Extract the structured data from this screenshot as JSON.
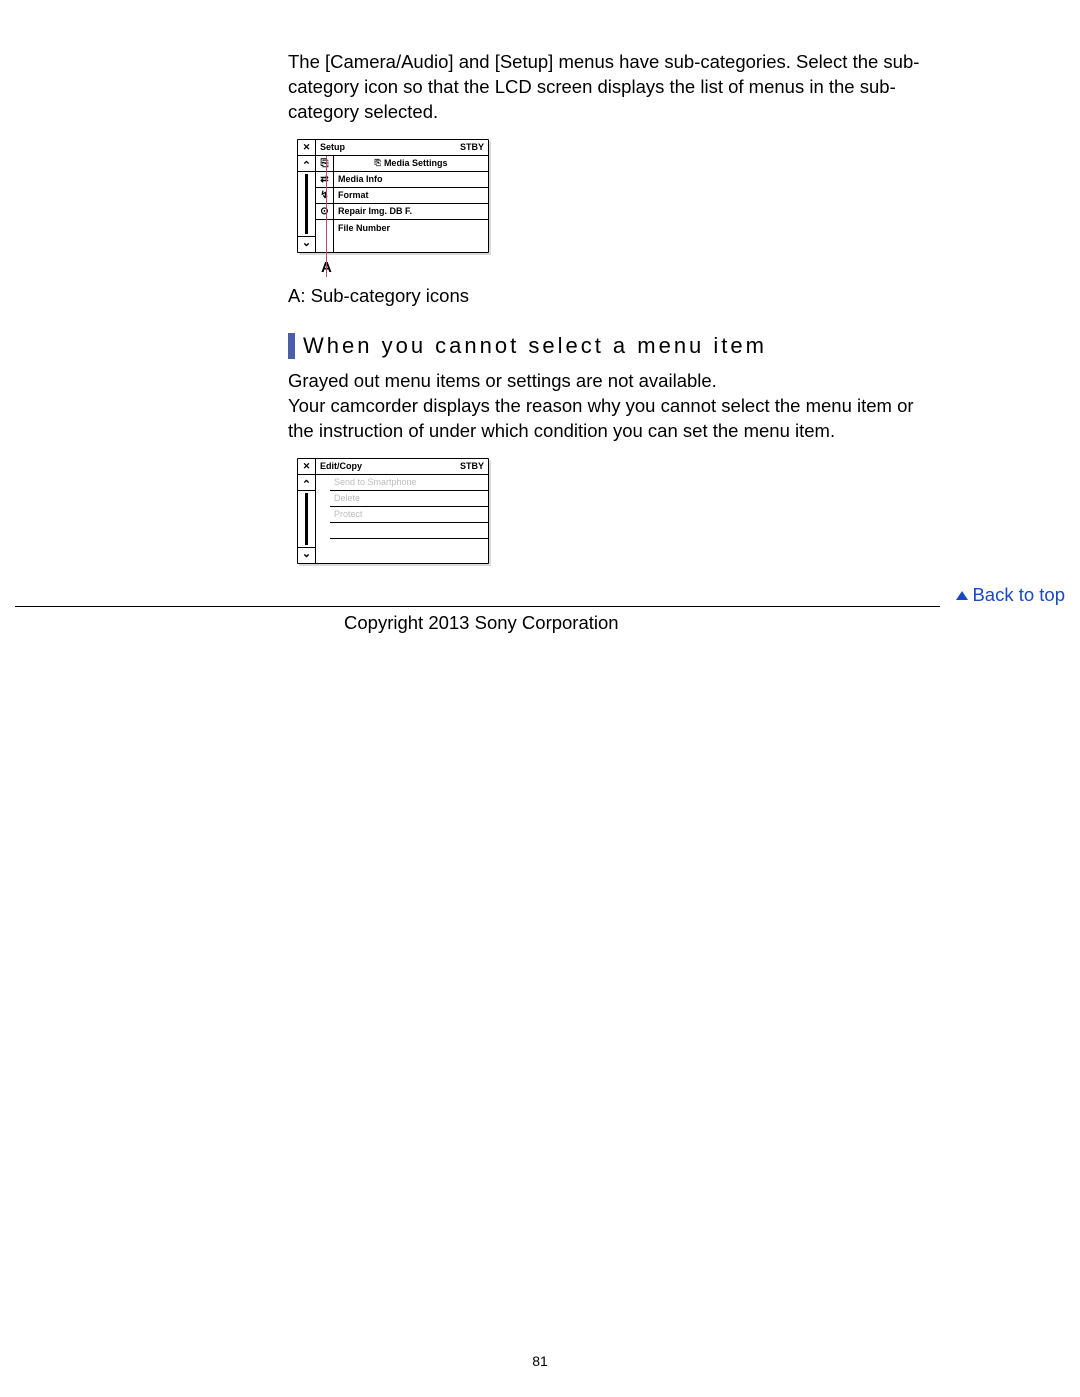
{
  "intro_paragraph": "The [Camera/Audio] and [Setup] menus have sub-categories. Select the sub-category icon so that the LCD screen displays the list of menus in the sub-category selected.",
  "figure1": {
    "header_left": "Setup",
    "header_right": "STBY",
    "subheader": "Media Settings",
    "items": [
      "Media Info",
      "Format",
      "Repair Img. DB F.",
      "File Number"
    ],
    "callout_letter": "A"
  },
  "caption_a": "A: Sub-category icons",
  "section_heading": "When you cannot select a menu item",
  "gray_para_line1": "Grayed out menu items or settings are not available.",
  "gray_para_line2": "Your camcorder displays the reason why you cannot select the menu item or the instruction of under which condition you can set the menu item.",
  "figure2": {
    "header_left": "Edit/Copy",
    "header_right": "STBY",
    "items": [
      "Send to Smartphone",
      "Delete",
      "Protect"
    ]
  },
  "back_to_top": "Back to top",
  "copyright": "Copyright 2013 Sony Corporation",
  "page_number": "81"
}
